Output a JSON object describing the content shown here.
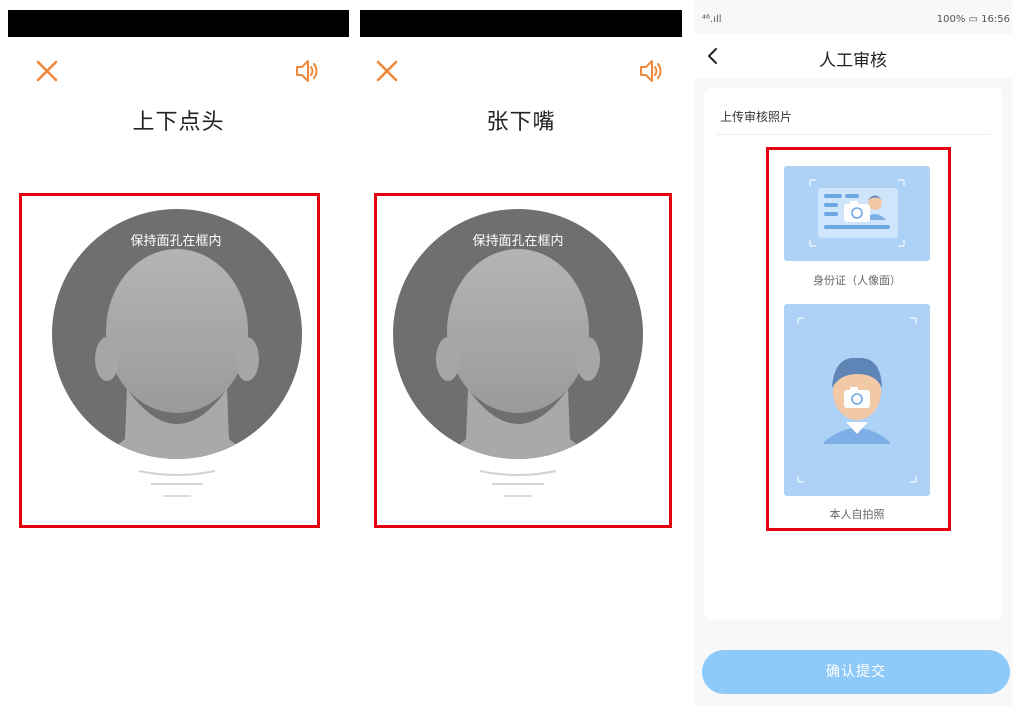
{
  "liveness_left": {
    "instruction": "上下点头",
    "hint": "保持面孔在框内"
  },
  "liveness_mid": {
    "instruction": "张下嘴",
    "hint": "保持面孔在框内"
  },
  "review": {
    "status_left": "⁴⁶.ıll",
    "status_right": "100% ▭ 16:56",
    "nav_title": "人工审核",
    "section_label": "上传审核照片",
    "id_caption": "身份证（人像面）",
    "selfie_caption": "本人自拍照",
    "submit_label": "确认提交"
  },
  "colors": {
    "accent_orange": "#ef8a3c",
    "highlight_red": "#e4000f",
    "tile_blue": "#aed2f5",
    "button_blue": "#8ec9f7"
  }
}
